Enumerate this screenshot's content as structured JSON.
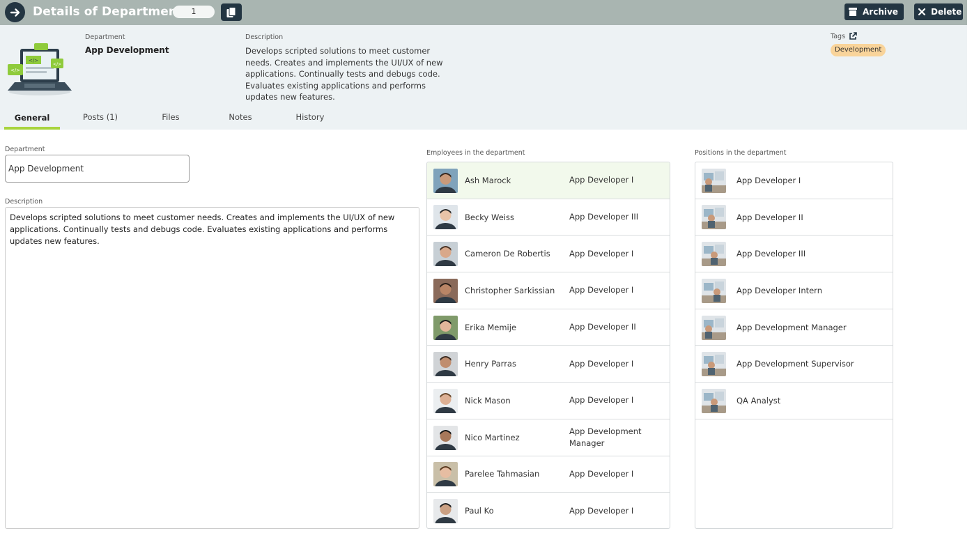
{
  "header": {
    "title": "Details of Department",
    "record_number": "1",
    "archive_label": "Archive",
    "delete_label": "Delete"
  },
  "summary": {
    "department_label": "Department",
    "department_value": "App Development",
    "description_label": "Description",
    "description_value": "Develops scripted solutions to meet customer needs. Creates and implements the UI/UX of new applications. Continually tests and debugs code. Evaluates existing applications and performs updates new features.",
    "tags_label": "Tags",
    "tags": [
      "Development"
    ]
  },
  "tabs": [
    {
      "label": "General",
      "active": true
    },
    {
      "label": "Posts (1)",
      "active": false
    },
    {
      "label": "Files",
      "active": false
    },
    {
      "label": "Notes",
      "active": false
    },
    {
      "label": "History",
      "active": false
    }
  ],
  "form": {
    "department_label": "Department",
    "department_value": "App Development",
    "description_label": "Description",
    "description_value": "Develops scripted solutions to meet customer needs. Creates and implements the UI/UX of new applications. Continually tests and debugs code. Evaluates existing applications and performs updates new features."
  },
  "employees": {
    "label": "Employees in the department",
    "items": [
      {
        "name": "Ash Marock",
        "title": "App Developer I",
        "selected": true
      },
      {
        "name": "Becky Weiss",
        "title": "App Developer III",
        "selected": false
      },
      {
        "name": "Cameron De Robertis",
        "title": "App Developer I",
        "selected": false
      },
      {
        "name": "Christopher Sarkissian",
        "title": "App Developer I",
        "selected": false
      },
      {
        "name": "Erika Memije",
        "title": "App Developer II",
        "selected": false
      },
      {
        "name": "Henry Parras",
        "title": "App Developer I",
        "selected": false
      },
      {
        "name": "Nick Mason",
        "title": "App Developer I",
        "selected": false
      },
      {
        "name": "Nico Martinez",
        "title": "App Development Manager",
        "selected": false
      },
      {
        "name": "Parelee Tahmasian",
        "title": "App Developer I",
        "selected": false
      },
      {
        "name": "Paul Ko",
        "title": "App Developer I",
        "selected": false
      }
    ]
  },
  "positions": {
    "label": "Positions in the department",
    "items": [
      {
        "name": "App Developer I"
      },
      {
        "name": "App Developer II"
      },
      {
        "name": "App Developer III"
      },
      {
        "name": "App Developer Intern"
      },
      {
        "name": "App Development Manager"
      },
      {
        "name": "App Development Supervisor"
      },
      {
        "name": "QA Analyst"
      }
    ]
  },
  "colors": {
    "topbar": "#a9b5b1",
    "navy": "#233542",
    "accent_green": "#a8d43e",
    "tag_bg": "#f9d49a",
    "header_bg": "#edf2f4"
  }
}
